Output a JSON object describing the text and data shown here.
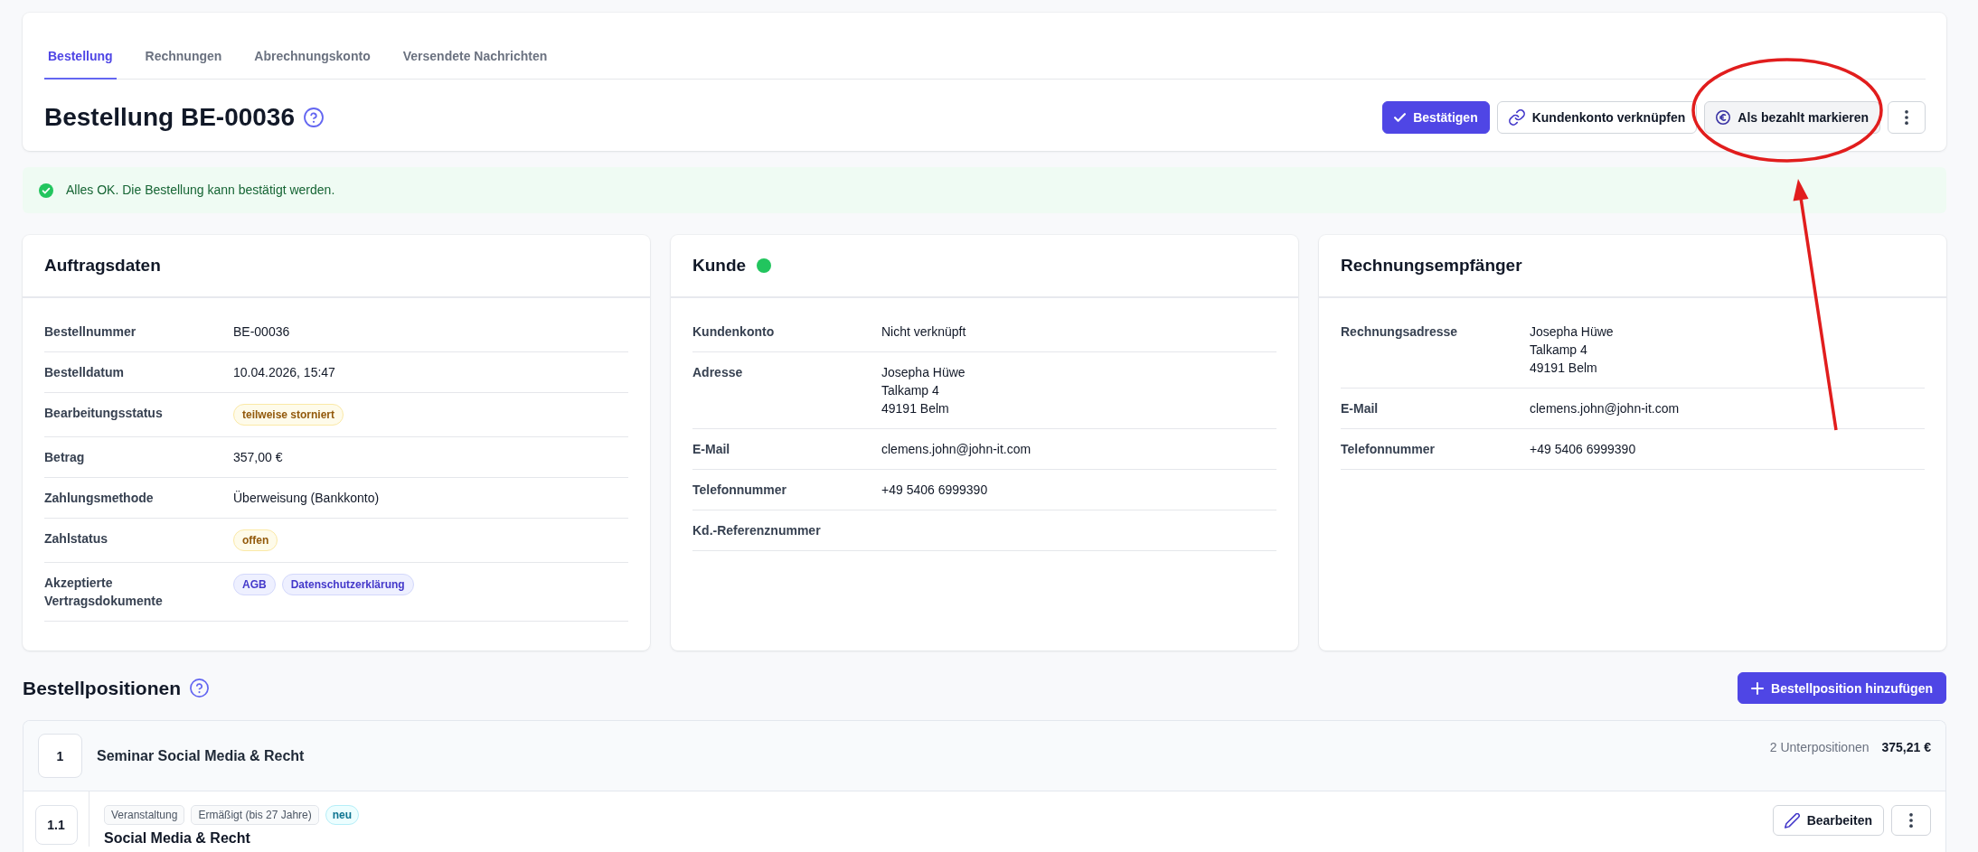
{
  "tabs": [
    {
      "label": "Bestellung",
      "selected": true
    },
    {
      "label": "Rechnungen",
      "selected": false
    },
    {
      "label": "Abrechnungskonto",
      "selected": false
    },
    {
      "label": "Versendete Nachrichten",
      "selected": false
    }
  ],
  "header": {
    "title": "Bestellung BE-00036",
    "actions": [
      {
        "kind": "confirm",
        "label": "Bestätigen",
        "hovered": false,
        "annotated": false
      },
      {
        "kind": "link",
        "label": "Kundenkonto verknüpfen",
        "hovered": false,
        "annotated": false
      },
      {
        "kind": "paid",
        "label": "Als bezahlt markieren",
        "hovered": true,
        "annotated": true
      },
      {
        "kind": "menu",
        "hovered": false,
        "annotated": false
      }
    ]
  },
  "alert": {
    "kind": "success",
    "text": "Alles OK. Die Bestellung kann bestätigt werden."
  },
  "cards": [
    {
      "title": "Auftragsdaten",
      "rows": [
        {
          "label": "Bestellnummer",
          "value": "BE-00036"
        },
        {
          "label": "Bestelldatum",
          "value": "10.04.2026, 15:47"
        },
        {
          "label": "Bearbeitungsstatus",
          "badges": [
            {
              "text": "teilweise storniert",
              "kind": "warning"
            }
          ]
        },
        {
          "label": "Betrag",
          "value": "357,00 €"
        },
        {
          "label": "Zahlungsmethode",
          "value": "Überweisung (Bankkonto)"
        },
        {
          "label": "Zahlstatus",
          "badges": [
            {
              "text": "offen",
              "kind": "warning"
            }
          ]
        },
        {
          "label": "Akzeptierte Vertragsdokumente",
          "badges": [
            {
              "text": "AGB",
              "kind": "info"
            },
            {
              "text": "Datenschutzerklärung",
              "kind": "info"
            }
          ]
        }
      ]
    },
    {
      "title": "Kunde",
      "color": "#22c55e",
      "rows": [
        {
          "label": "Kundenkonto",
          "value": "Nicht verknüpft"
        },
        {
          "label": "Adresse",
          "lines": [
            "Josepha Hüwe",
            "Talkamp 4",
            "49191 Belm"
          ]
        },
        {
          "label": "E-Mail",
          "value": "clemens.john@john-it.com"
        },
        {
          "label": "Telefonnummer",
          "value": "+49 5406 6999390"
        },
        {
          "label": "Kd.-Referenznummer"
        }
      ]
    },
    {
      "title": "Rechnungsempfänger",
      "rows": [
        {
          "label": "Rechnungsadresse",
          "lines": [
            "Josepha Hüwe",
            "Talkamp 4",
            "49191 Belm"
          ]
        },
        {
          "label": "E-Mail",
          "value": "clemens.john@john-it.com"
        },
        {
          "label": "Telefonnummer",
          "value": "+49 5406 6999390"
        }
      ]
    }
  ],
  "positions": {
    "title": "Bestellpositionen",
    "add_button": "Bestellposition hinzufügen",
    "groups": [
      {
        "number": "1",
        "title": "Seminar Social Media & Recht",
        "count": "2 Unterpositionen",
        "total": "375,21 €",
        "children": [
          {
            "number": "1.1",
            "tags": [
              {
                "text": "Veranstaltung",
                "kind": "neutral"
              },
              {
                "text": "Ermäßigt (bis 27 Jahre)",
                "kind": "neutral"
              },
              {
                "text": "neu",
                "kind": "new"
              }
            ],
            "title": "Social Media & Recht",
            "edit_button": "Bearbeiten"
          }
        ]
      }
    ]
  }
}
